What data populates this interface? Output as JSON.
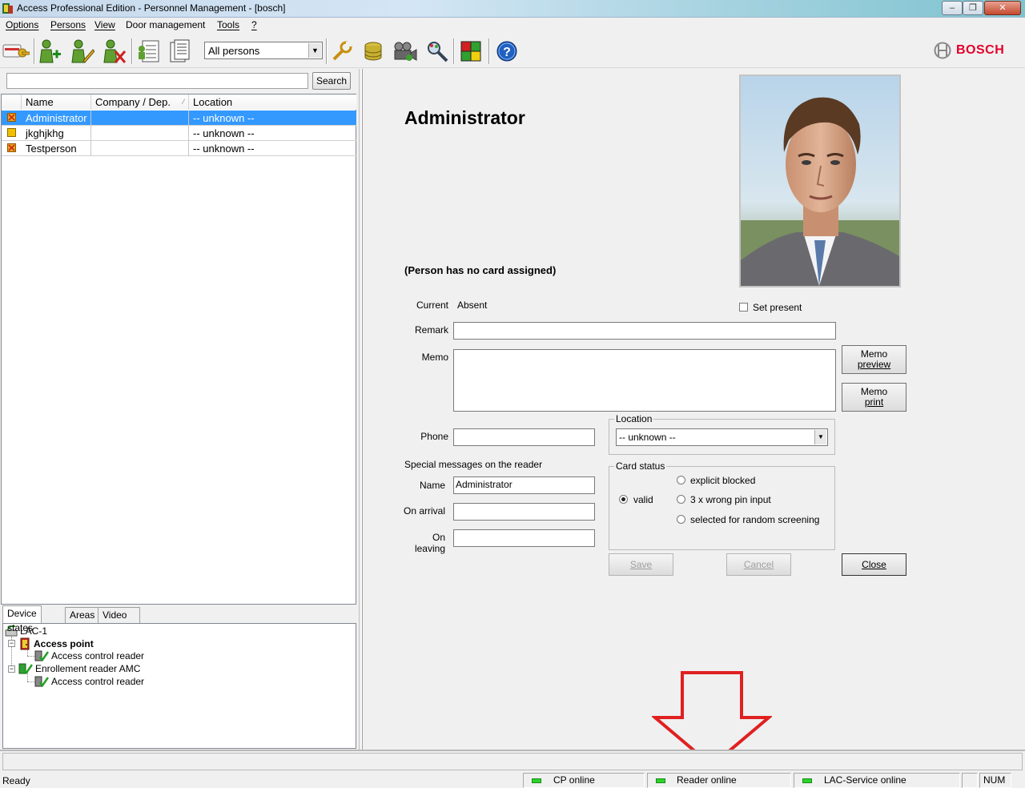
{
  "window": {
    "title": "Access Professional Edition - Personnel Management - [bosch]"
  },
  "menu": [
    "Options",
    "Persons",
    "View",
    "Door management",
    "Tools",
    "?"
  ],
  "toolbar": {
    "filter_selected": "All persons",
    "brand": "BOSCH",
    "icons": [
      "card-key-icon",
      "add-person-icon",
      "edit-person-icon",
      "delete-person-icon",
      "person-list-icon",
      "reports-icon",
      "tools-icon",
      "database-icon",
      "video-icon",
      "search-zoom-icon",
      "color-grid-icon",
      "help-icon"
    ]
  },
  "search": {
    "value": "",
    "button": "Search"
  },
  "person_list": {
    "columns": [
      "Name",
      "Company / Dep.",
      "Location"
    ],
    "rows": [
      {
        "name": "Administrator",
        "company": "",
        "location": "-- unknown --",
        "status_color": "#f0a020",
        "crossed": true
      },
      {
        "name": "jkghjkhg",
        "company": "",
        "location": "-- unknown --",
        "status_color": "#f0c000",
        "crossed": false
      },
      {
        "name": "Testperson",
        "company": "",
        "location": "-- unknown --",
        "status_color": "#f0a020",
        "crossed": true
      }
    ]
  },
  "device_tabs": [
    "Device states",
    "Areas",
    "Video devices"
  ],
  "device_tree": {
    "root": "LAC-1",
    "nodes": [
      {
        "label": "Access point",
        "child": "Access control reader"
      },
      {
        "label": "Enrollement reader AMC",
        "child": "Access control reader"
      }
    ]
  },
  "detail": {
    "name": "Administrator",
    "no_card": "(Person has no card assigned)",
    "current_label": "Current",
    "current_value": "Absent",
    "set_present": "Set present",
    "remark_label": "Remark",
    "remark_value": "",
    "memo_label": "Memo",
    "memo_value": "",
    "memo_preview_1": "Memo",
    "memo_preview_2": "preview",
    "memo_print_1": "Memo",
    "memo_print_2": "print",
    "phone_label": "Phone",
    "phone_value": "",
    "location_group": "Location",
    "location_value": "-- unknown --",
    "special_messages": "Special messages on the reader",
    "msg_name_label": "Name",
    "msg_name_value": "Administrator",
    "on_arrival_label": "On arrival",
    "on_arrival_value": "",
    "on_leaving_label": "On leaving",
    "on_leaving_value": "",
    "card_status_group": "Card status",
    "card_status_valid": "valid",
    "card_status_blocked": "explicit blocked",
    "card_status_wrong_pin": "3 x wrong pin input",
    "card_status_screening": "selected for random screening",
    "save": "Save",
    "cancel": "Cancel",
    "close": "Close"
  },
  "statusbar": {
    "ready": "Ready",
    "cp": "CP online",
    "reader": "Reader online",
    "lac": "LAC-Service online",
    "num": "NUM"
  },
  "colors": {
    "selection": "#3399ff",
    "led_online": "#2bd42b",
    "brand_red": "#e4002b",
    "annotation_arrow": "#e02020"
  }
}
